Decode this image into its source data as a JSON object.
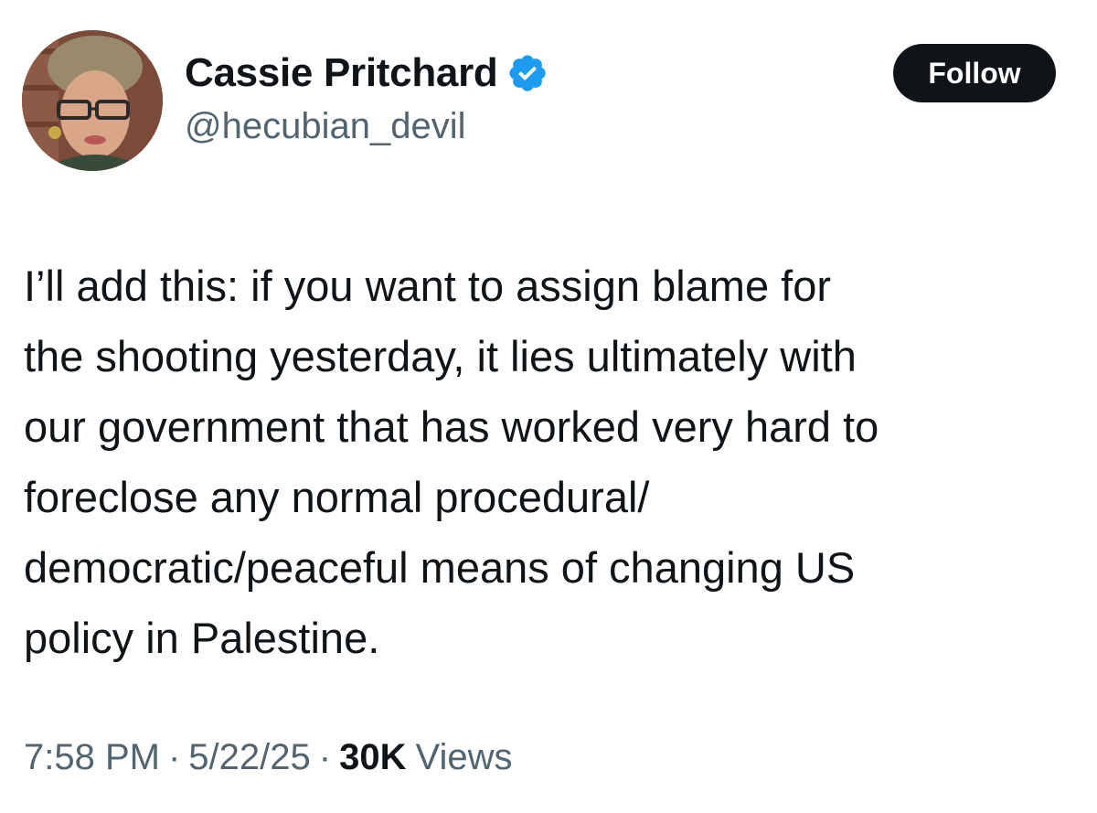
{
  "user": {
    "display_name": "Cassie Pritchard",
    "handle": "@hecubian_devil",
    "verified_icon": "verified-badge-icon",
    "verified_color": "#1d9bf0"
  },
  "follow_button": {
    "label": "Follow"
  },
  "tweet": {
    "lines": [
      "I’ll add this: if you want to assign blame for",
      "the shooting yesterday, it lies ultimately with",
      "our government that has worked very hard to",
      "foreclose any normal procedural/",
      "democratic/peaceful means of changing US",
      "policy in Palestine."
    ]
  },
  "meta": {
    "time": "7:58 PM",
    "separator": "·",
    "date": "5/22/25",
    "views_count": "30K",
    "views_label": "Views"
  },
  "colors": {
    "text_primary": "#0f1419",
    "text_secondary": "#536471",
    "button_bg": "#0f1419",
    "button_text": "#ffffff"
  }
}
